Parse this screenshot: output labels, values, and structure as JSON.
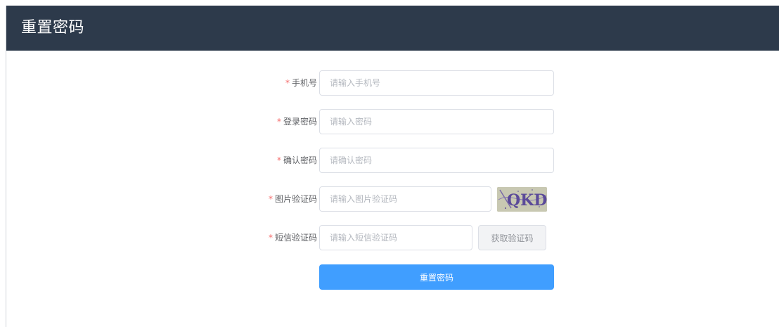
{
  "header": {
    "title": "重置密码"
  },
  "form": {
    "required_mark": "*",
    "phone": {
      "label": "手机号",
      "placeholder": "请输入手机号"
    },
    "password": {
      "label": "登录密码",
      "placeholder": "请输入密码"
    },
    "confirm_password": {
      "label": "确认密码",
      "placeholder": "请确认密码"
    },
    "image_captcha": {
      "label": "图片验证码",
      "placeholder": "请输入图片验证码",
      "captcha_text": "QKD"
    },
    "sms_code": {
      "label": "短信验证码",
      "placeholder": "请输入短信验证码",
      "button_label": "获取验证码"
    },
    "submit_label": "重置密码"
  },
  "colors": {
    "header_bg": "#2d3a4b",
    "primary": "#409eff",
    "required": "#f56c6c"
  }
}
